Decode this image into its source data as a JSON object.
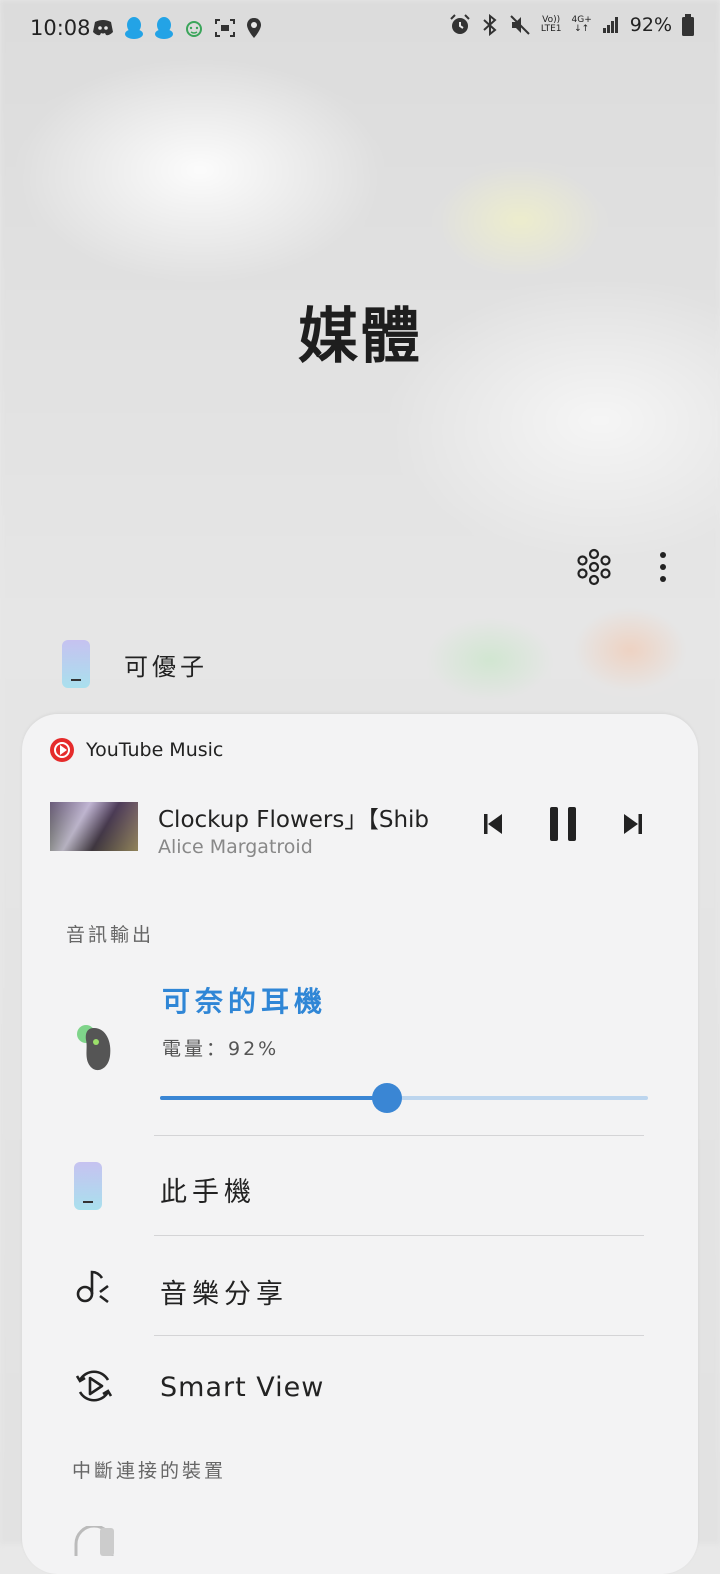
{
  "status_bar": {
    "time": "10:08",
    "network_top": "Vo))",
    "network_bottom": "LTE1",
    "net_type": "4G+",
    "battery": "92%"
  },
  "page": {
    "title": "媒體",
    "current_device": "可優子"
  },
  "media": {
    "app_name": "YouTube Music",
    "track_title": "Clockup Flowers」【Shib",
    "artist": "Alice Margatroid"
  },
  "audio_output": {
    "section_label": "音訊輸出",
    "connected_name": "可奈的耳機",
    "battery_text": "電量：92%",
    "volume_fraction": 0.465,
    "options": [
      {
        "label": "此手機"
      },
      {
        "label": "音樂分享"
      },
      {
        "label": "Smart View"
      }
    ]
  },
  "disconnected": {
    "section_label": "中斷連接的裝置"
  },
  "colors": {
    "accent": "#3a86d4",
    "youtube_red": "#e52b2b"
  }
}
